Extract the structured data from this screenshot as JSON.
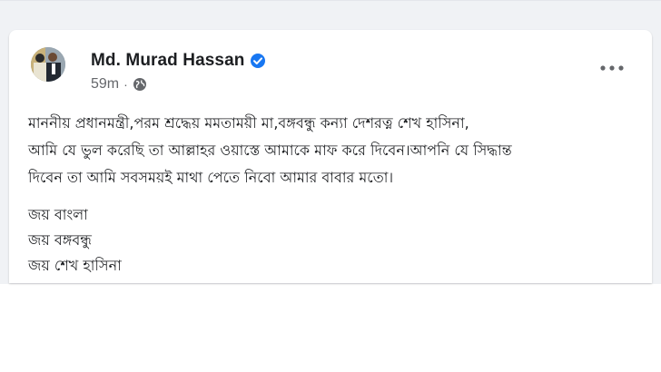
{
  "post": {
    "author": {
      "name": "Md. Murad Hassan",
      "verified": true,
      "avatar_icon": "profile-photo-avatar"
    },
    "meta": {
      "time": "59m",
      "separator": "·",
      "audience_icon": "globe-icon"
    },
    "more_icon": "more-options-icon",
    "body": {
      "paragraph1_lines": [
        "মাননীয় প্রধানমন্ত্রী,পরম শ্রদ্ধেয় মমতাময়ী মা,বঙ্গবন্ধু কন্যা দেশরত্ন শেখ হাসিনা,",
        "আমি যে ভুল করেছি তা আল্লাহর ওয়াস্তে আমাকে মাফ করে দিবেন।আপনি যে সিদ্ধান্ত",
        "দিবেন তা আমি সবসময়ই মাথা পেতে নিবো আমার বাবার মতো।"
      ],
      "slogans": [
        "জয় বাংলা",
        "জয় বঙ্গবন্ধু",
        "জয় শেখ হাসিনা"
      ]
    }
  },
  "colors": {
    "background": "#f0f2f5",
    "card": "#ffffff",
    "text_primary": "#1c1e21",
    "text_secondary": "#65676b",
    "verified_blue": "#1877f2"
  }
}
